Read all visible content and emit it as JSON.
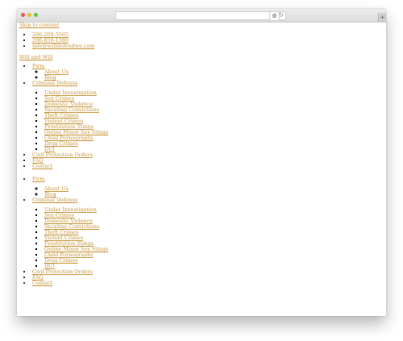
{
  "browser": {
    "window_controls": [
      "close",
      "minimize",
      "zoom"
    ],
    "address_value": "",
    "reload_icon": "reload-icon",
    "extension_icon": "gear-icon",
    "new_tab_label": "+"
  },
  "page": {
    "skip_link": "Skip to content",
    "contacts": [
      "206-209-5565",
      "206-858-1380",
      "info@willdefendwa.com"
    ],
    "brand": "Will and Will",
    "menu": {
      "firm": "Firm",
      "firm_items": [
        "About Us",
        "Blog"
      ],
      "criminal_defense": "Criminal Defense",
      "criminal_items": [
        "Under Investigation",
        "Sex Crimes",
        "Domestic Violence",
        "Vacating Convictions",
        "Theft Crimes",
        "Violent Crimes",
        "Prostitution Stings",
        "Online Minor Sex Stings",
        "Child Pornography",
        "Drug Crimes",
        "DUI"
      ],
      "civil_protection": "Civil Protection Orders",
      "faq": "FAQ",
      "contact": "Contact"
    }
  },
  "colors": {
    "link": "#c8963b",
    "close": "#ee5a52",
    "minimize": "#f5bd32",
    "zoom": "#5fc93f"
  }
}
